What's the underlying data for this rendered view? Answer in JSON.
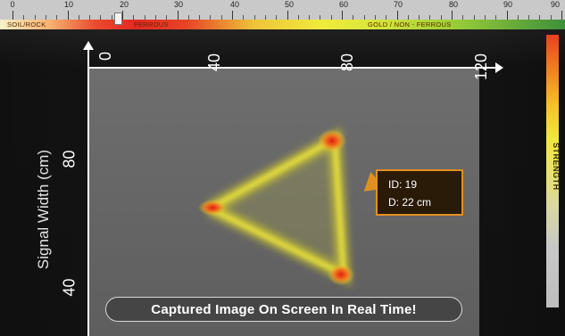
{
  "scale": {
    "numbers": [
      "0",
      "10",
      "20",
      "30",
      "40",
      "50",
      "60",
      "70",
      "80",
      "90",
      "90"
    ],
    "segments": [
      "SOIL/ROCK",
      "FERROUS",
      "GOLD / NON - FERROUS"
    ],
    "marker_value": 20
  },
  "x_axis": {
    "ticks": [
      "0",
      "40",
      "80",
      "120"
    ]
  },
  "y_axis": {
    "label": "Signal Width (cm)",
    "ticks": [
      "80",
      "40"
    ]
  },
  "strength_label": "STRENGTH",
  "target_info": {
    "id": "ID: 19",
    "depth": "D: 22 cm"
  },
  "banner": "Captured Image On Screen In Real Time!",
  "colors": {
    "accent": "#e09020",
    "signal_yellow": "#e6e020",
    "signal_red": "#e83010"
  }
}
